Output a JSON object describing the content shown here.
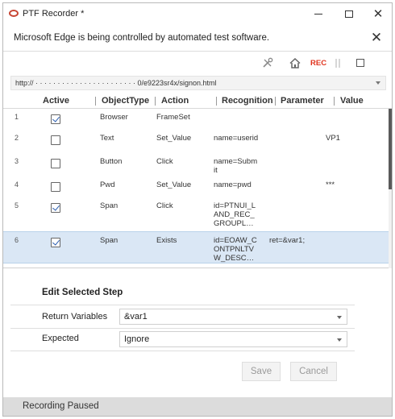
{
  "window": {
    "title": "PTF Recorder *",
    "close_glyph": "✕"
  },
  "banner": {
    "text": "Microsoft Edge is being controlled by automated test software.",
    "close_glyph": "✕"
  },
  "toolbar": {
    "edit_icon": "tools-icon",
    "home_icon": "home-icon",
    "rec_label": "REC",
    "pause_icon": "pause-icon",
    "stop_icon": "stop-icon"
  },
  "url": {
    "value": "http://  ·  ·  ·  ·  ·  ·  ·  ·  ·  ·  ·  ·  ·  ·  ·  ·  ·  ·  ·  ·  ·  ·  · 0/e9223sr4x/signon.html"
  },
  "grid": {
    "columns": {
      "active": "Active",
      "object_type": "ObjectType",
      "action": "Action",
      "recognition": "Recognition",
      "parameter": "Parameter",
      "value": "Value"
    },
    "rows": [
      {
        "num": "1",
        "active": true,
        "type": "Browser",
        "action": "FrameSet",
        "recognition": "",
        "parameter": "",
        "value": ""
      },
      {
        "num": "2",
        "active": false,
        "type": "Text",
        "action": "Set_Value",
        "recognition": "name=userid",
        "parameter": "",
        "value": "VP1"
      },
      {
        "num": "3",
        "active": false,
        "type": "Button",
        "action": "Click",
        "recognition": "name=Submit",
        "parameter": "",
        "value": ""
      },
      {
        "num": "4",
        "active": false,
        "type": "Pwd",
        "action": "Set_Value",
        "recognition": "name=pwd",
        "parameter": "",
        "value": "***"
      },
      {
        "num": "5",
        "active": true,
        "type": "Span",
        "action": "Click",
        "recognition": "id=PTNUI_LAND_REC_GROUPL…",
        "parameter": "",
        "value": ""
      },
      {
        "num": "6",
        "active": true,
        "type": "Span",
        "action": "Exists",
        "recognition": "id=EOAW_CONTPNLTVW_DESC…",
        "parameter": "ret=&var1;",
        "value": "",
        "selected": true
      }
    ]
  },
  "edit": {
    "title": "Edit Selected Step",
    "return_label": "Return Variables",
    "return_value": "&var1",
    "expected_label": "Expected",
    "expected_value": "Ignore",
    "save_label": "Save",
    "cancel_label": "Cancel"
  },
  "status": {
    "text": "Recording Paused"
  },
  "colors": {
    "accent_red": "#e0341e",
    "selected_row": "#dae7f5",
    "status_bg": "#dcdcdc"
  }
}
